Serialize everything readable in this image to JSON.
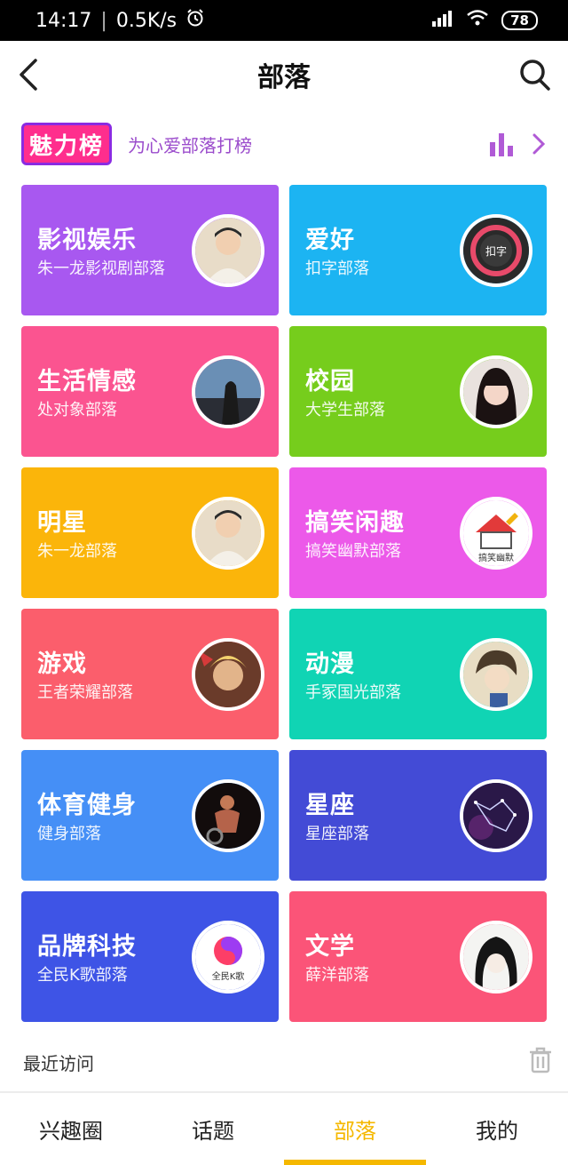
{
  "status": {
    "time": "14:17",
    "speed": "0.5K/s",
    "battery": "78"
  },
  "nav": {
    "title": "部落"
  },
  "banner": {
    "logo_text": "魅力榜",
    "text": "为心爱部落打榜"
  },
  "cards": [
    {
      "title": "影视娱乐",
      "sub": "朱一龙影视剧部落",
      "color": "#a858f0",
      "avatar": "person-icon"
    },
    {
      "title": "爱好",
      "sub": "扣字部落",
      "color": "#1cb4f2",
      "avatar": "gauge-icon"
    },
    {
      "title": "生活情感",
      "sub": "处对象部落",
      "color": "#fb5490",
      "avatar": "silhouette-icon"
    },
    {
      "title": "校园",
      "sub": "大学生部落",
      "color": "#76cd1c",
      "avatar": "girl-icon"
    },
    {
      "title": "明星",
      "sub": "朱一龙部落",
      "color": "#fbb50a",
      "avatar": "person-icon"
    },
    {
      "title": "搞笑闲趣",
      "sub": "搞笑幽默部落",
      "color": "#ec59e9",
      "avatar": "house-pencil-icon"
    },
    {
      "title": "游戏",
      "sub": "王者荣耀部落",
      "color": "#fb5e6c",
      "avatar": "game-hero-icon"
    },
    {
      "title": "动漫",
      "sub": "手冢国光部落",
      "color": "#10d4b4",
      "avatar": "anime-icon"
    },
    {
      "title": "体育健身",
      "sub": "健身部落",
      "color": "#458ff6",
      "avatar": "fitness-icon"
    },
    {
      "title": "星座",
      "sub": "星座部落",
      "color": "#434bd6",
      "avatar": "constellation-icon"
    },
    {
      "title": "品牌科技",
      "sub": "全民K歌部落",
      "color": "#3e54e6",
      "avatar": "app-logo-icon"
    },
    {
      "title": "文学",
      "sub": "薛洋部落",
      "color": "#fb5478",
      "avatar": "ink-portrait-icon"
    }
  ],
  "recent": {
    "label": "最近访问"
  },
  "tabs": [
    {
      "label": "兴趣圈",
      "active": false
    },
    {
      "label": "话题",
      "active": false
    },
    {
      "label": "部落",
      "active": true
    },
    {
      "label": "我的",
      "active": false
    }
  ],
  "colors": {
    "accent": "#f5b800",
    "banner_text": "#9b4ccc",
    "icon_purple": "#b05ad6"
  }
}
